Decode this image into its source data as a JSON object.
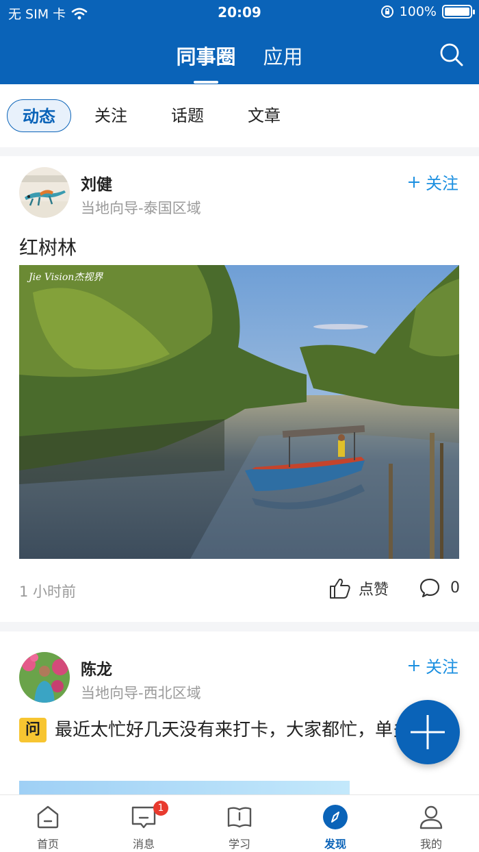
{
  "status_bar": {
    "carrier": "无 SIM 卡",
    "time": "20:09",
    "battery": "100%"
  },
  "header": {
    "tabs": [
      {
        "label": "同事圈",
        "active": true
      },
      {
        "label": "应用",
        "active": false
      }
    ],
    "search_icon": "search-icon"
  },
  "sub_tabs": [
    {
      "label": "动态",
      "active": true
    },
    {
      "label": "关注",
      "active": false
    },
    {
      "label": "话题",
      "active": false
    },
    {
      "label": "文章",
      "active": false
    }
  ],
  "posts": [
    {
      "author": "刘健",
      "subtitle": "当地向导-泰国区域",
      "follow_label": "关注",
      "title": "红树林",
      "image_watermark": "Jie Vision杰视界",
      "time": "1 小时前",
      "like_label": "点赞",
      "comment_count": "0"
    },
    {
      "author": "陈龙",
      "subtitle": "当地向导-西北区域",
      "follow_label": "关注",
      "question_badge": "问",
      "text": "最近太忙好几天没有来打卡，大家都忙，单多吗?"
    }
  ],
  "bottom_nav": [
    {
      "label": "首页",
      "icon": "home-icon",
      "active": false
    },
    {
      "label": "消息",
      "icon": "message-icon",
      "active": false,
      "badge": "1"
    },
    {
      "label": "学习",
      "icon": "book-icon",
      "active": false
    },
    {
      "label": "发现",
      "icon": "compass-icon",
      "active": true
    },
    {
      "label": "我的",
      "icon": "user-icon",
      "active": false
    }
  ],
  "colors": {
    "primary": "#0a63b8",
    "follow": "#1a8fe0",
    "badge_red": "#e83a2e",
    "question_yellow": "#f7c531"
  }
}
